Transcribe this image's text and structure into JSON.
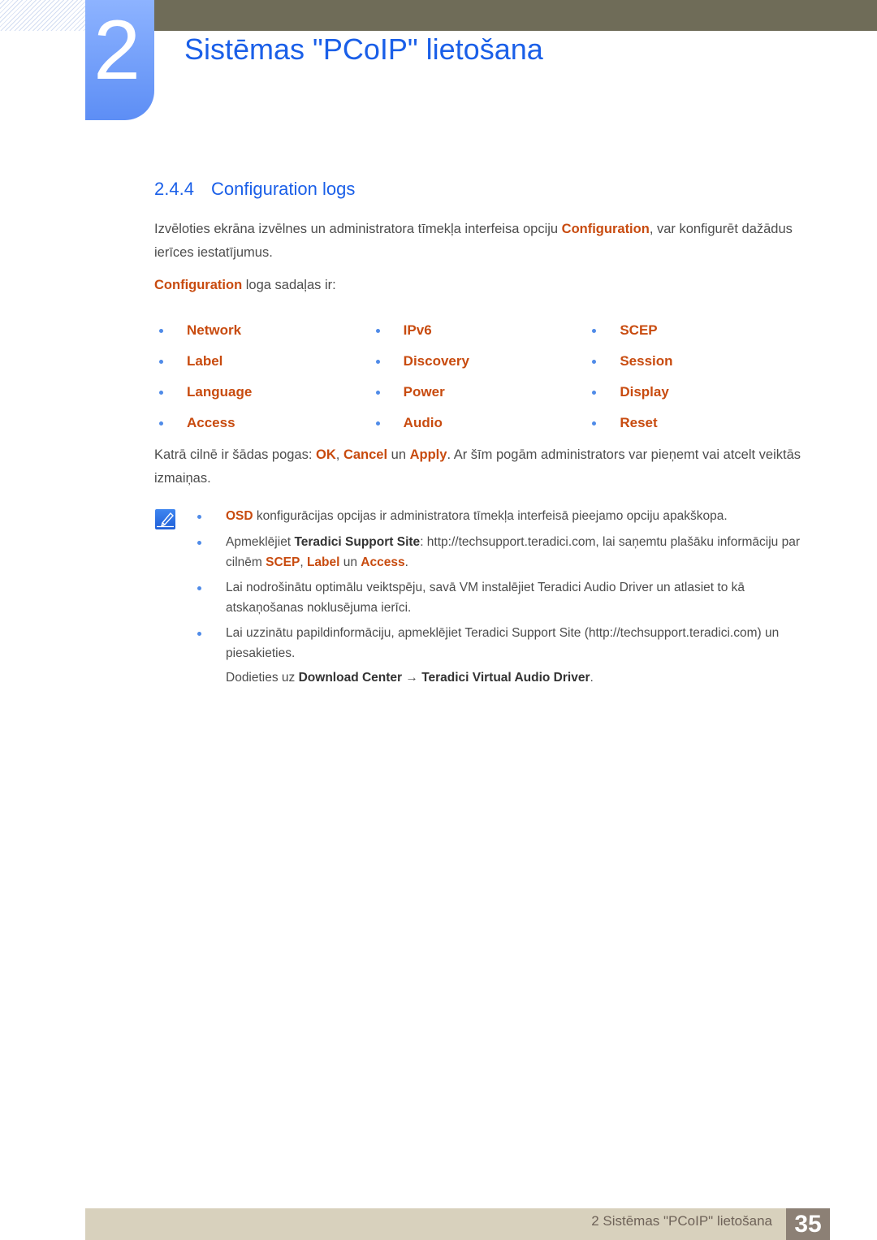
{
  "header": {
    "chapter_number": "2",
    "chapter_title": "Sistēmas \"PCoIP\" lietošana"
  },
  "section": {
    "number": "2.4.4",
    "title": "Configuration logs"
  },
  "intro": {
    "text_before": "Izvēloties ekrāna izvēlnes un administratora tīmekļa interfeisa opciju ",
    "highlight": "Configuration",
    "text_after": ", var konfigurēt dažādus ierīces iestatījumus."
  },
  "sections_intro": {
    "highlight": "Configuration",
    "text": " loga sadaļas ir:"
  },
  "tabs_list": [
    [
      "Network",
      "IPv6",
      "SCEP"
    ],
    [
      "Label",
      "Discovery",
      "Session"
    ],
    [
      "Language",
      "Power",
      "Display"
    ],
    [
      "Access",
      "Audio",
      "Reset"
    ]
  ],
  "buttons_para": {
    "t1": "Katrā cilnē ir šādas pogas: ",
    "ok": "OK",
    "t2": ", ",
    "cancel": "Cancel",
    "t3": " un ",
    "apply": "Apply",
    "t4": ". Ar šīm pogām administrators var pieņemt vai atcelt veiktās izmaiņas."
  },
  "notes": {
    "icon": "note-pencil-icon",
    "n1": {
      "highlight": "OSD",
      "text": " konfigurācijas opcijas ir administratora tīmekļa interfeisā pieejamo opciju apakškopa."
    },
    "n2": {
      "t1": "Apmeklējiet ",
      "bold": "Teradici Support Site",
      "t2": ": http://techsupport.teradici.com, lai saņemtu plašāku informāciju par cilnēm ",
      "scep": "SCEP",
      "t3": ", ",
      "label": "Label",
      "t4": " un ",
      "access": "Access",
      "t5": "."
    },
    "n3": {
      "text": "Lai nodrošinātu optimālu veiktspēju, savā VM instalējiet Teradici Audio Driver un atlasiet to kā atskaņošanas noklusējuma ierīci."
    },
    "n4": {
      "text": "Lai uzzinātu papildinformāciju, apmeklējiet Teradici Support Site (http://techsupport.teradici.com) un piesakieties."
    },
    "n5": {
      "t1": "Dodieties uz ",
      "b1": "Download Center",
      "arrow": " → ",
      "b2": "Teradici Virtual Audio Driver",
      "t2": "."
    }
  },
  "footer": {
    "text": "2 Sistēmas \"PCoIP\" lietošana",
    "page_number": "35"
  }
}
